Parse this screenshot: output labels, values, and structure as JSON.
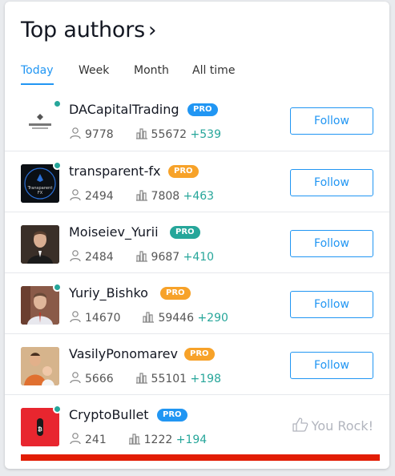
{
  "header": {
    "title": "Top authors",
    "chevron": "›"
  },
  "tabs": [
    {
      "label": "Today",
      "active": true
    },
    {
      "label": "Week"
    },
    {
      "label": "Month"
    },
    {
      "label": "All time"
    }
  ],
  "authors": [
    {
      "name": "DACapitalTrading",
      "badge": "PRO",
      "badge_color": "#2196f3",
      "online": true,
      "followers": "9778",
      "ideas": "55672",
      "delta": "+539",
      "action": "Follow",
      "avatar": "dacapital-logo"
    },
    {
      "name": "transparent-fx",
      "badge": "PRO",
      "badge_color": "#f7a229",
      "online": true,
      "followers": "2494",
      "ideas": "7808",
      "delta": "+463",
      "action": "Follow",
      "avatar": "transparent-fx-logo",
      "avatar_text": "Transparent FX"
    },
    {
      "name": "Moiseiev_Yurii",
      "badge": "PRO",
      "badge_color": "#26a69a",
      "online": false,
      "followers": "2484",
      "ideas": "9687",
      "delta": "+410",
      "action": "Follow",
      "avatar": "portrait-photo"
    },
    {
      "name": "Yuriy_Bishko",
      "badge": "PRO",
      "badge_color": "#f7a229",
      "online": true,
      "followers": "14670",
      "ideas": "59446",
      "delta": "+290",
      "action": "Follow",
      "avatar": "portrait-photo"
    },
    {
      "name": "VasilyPonomarev",
      "badge": "PRO",
      "badge_color": "#f7a229",
      "online": false,
      "followers": "5666",
      "ideas": "55101",
      "delta": "+198",
      "action": "Follow",
      "avatar": "family-photo"
    },
    {
      "name": "CryptoBullet",
      "badge": "PRO",
      "badge_color": "#2196f3",
      "online": true,
      "followers": "241",
      "ideas": "1222",
      "delta": "+194",
      "action": "You Rock!",
      "avatar": "cryptobullet-logo"
    }
  ],
  "icons": {
    "followers": "user-icon",
    "ideas": "chart-bars-icon",
    "you_rock": "thumbs-up-icon"
  },
  "colors": {
    "accent": "#2196f3",
    "positive": "#26a69a",
    "online": "#26a69a",
    "red_bar": "#e21d04"
  }
}
